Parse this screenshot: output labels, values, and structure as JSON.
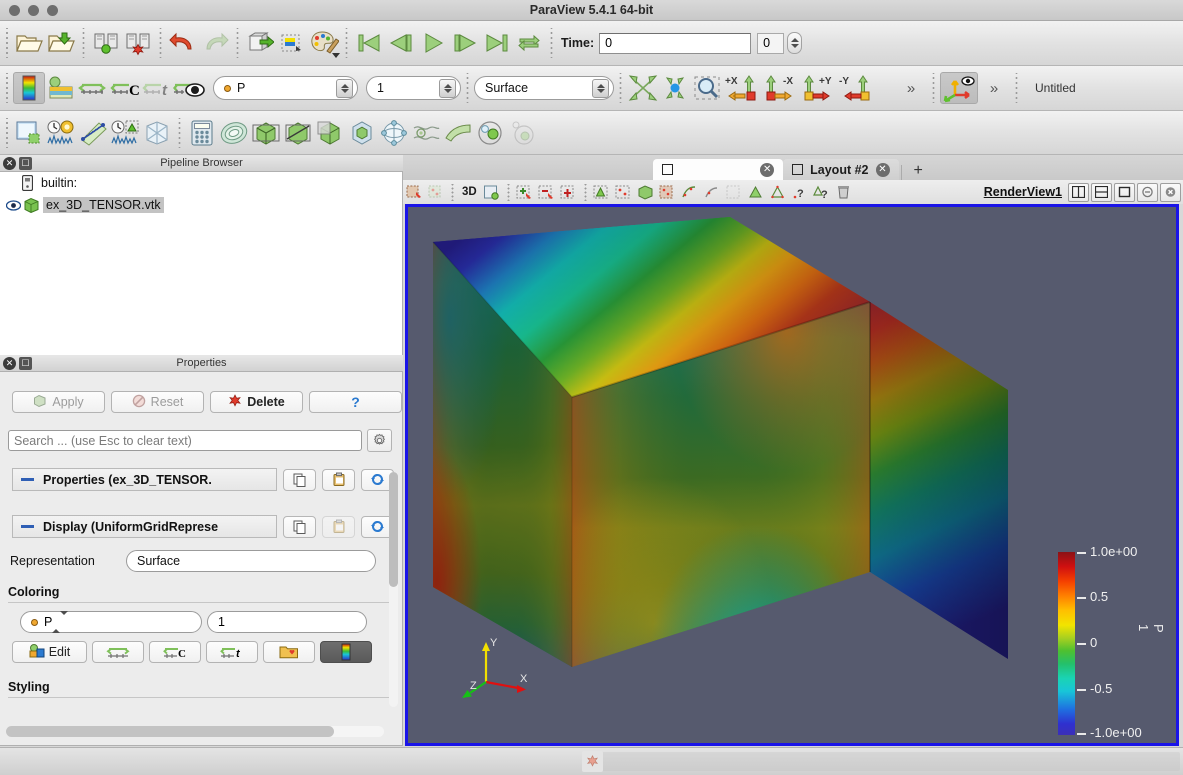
{
  "window": {
    "title": "ParaView 5.4.1 64-bit",
    "traffic_lights": [
      "close",
      "minimize",
      "zoom"
    ]
  },
  "main_toolbar": {
    "buttons": [
      {
        "name": "open-file-icon",
        "label": "Open"
      },
      {
        "name": "save-data-icon",
        "label": "Save Data"
      },
      {
        "name": "connect-server-icon",
        "label": "Connect"
      },
      {
        "name": "disconnect-server-icon",
        "label": "Disconnect"
      },
      {
        "name": "undo-icon",
        "label": "Undo"
      },
      {
        "name": "redo-icon",
        "label": "Redo"
      },
      {
        "name": "undo-camera-icon",
        "label": "Undo Camera"
      },
      {
        "name": "redo-camera-icon",
        "label": "Redo Camera"
      },
      {
        "name": "color-palette-icon",
        "label": "Edit Color Palette"
      }
    ]
  },
  "vcr_toolbar": {
    "buttons": [
      {
        "name": "first-frame-icon",
        "label": "First Frame"
      },
      {
        "name": "previous-frame-icon",
        "label": "Previous Frame"
      },
      {
        "name": "play-icon",
        "label": "Play"
      },
      {
        "name": "next-frame-icon",
        "label": "Next Frame"
      },
      {
        "name": "last-frame-icon",
        "label": "Last Frame"
      },
      {
        "name": "loop-icon",
        "label": "Loop"
      }
    ],
    "time_label": "Time:",
    "time_value": "0",
    "frame_value": "0"
  },
  "rep_toolbar": {
    "active_scalars_icon": "colormap-icon",
    "buttons": [
      {
        "name": "rescale-to-data-range-icon",
        "label": "Rescale to Data Range"
      },
      {
        "name": "rescale-custom-range-icon",
        "label": "Rescale to Custom Range"
      },
      {
        "name": "rescale-temporal-range-icon",
        "label": "Rescale to Temporal Range"
      },
      {
        "name": "rescale-visible-range-icon",
        "label": "Rescale to Visible Range"
      },
      {
        "name": "toggle-color-legend-icon",
        "label": "Toggle Color Legend"
      }
    ],
    "array_value": "P",
    "component_value": "1",
    "representation_value": "Surface",
    "camera_buttons": [
      {
        "name": "reset-camera-icon",
        "label": "Reset"
      },
      {
        "name": "zoom-to-data-icon",
        "label": "Zoom To Data"
      },
      {
        "name": "zoom-to-box-icon",
        "label": "Zoom To Box"
      },
      {
        "name": "pos-x-icon",
        "label": "+X"
      },
      {
        "name": "neg-x-icon",
        "label": "-X"
      },
      {
        "name": "pos-y-icon",
        "label": "+Y"
      },
      {
        "name": "neg-y-icon",
        "label": "-Y"
      }
    ],
    "overflow_label": "»",
    "orientation_axes_icon": "show-orientation-axes-icon",
    "untitled_label": "Untitled"
  },
  "filters_toolbar": {
    "buttons": [
      {
        "name": "extract-selection-icon",
        "label": "Extract Selection"
      },
      {
        "name": "plot-over-time-icon",
        "label": "Plot Data Over Time"
      },
      {
        "name": "plot-over-line-icon",
        "label": "Plot Over Line"
      },
      {
        "name": "plot-selection-over-time-icon",
        "label": "Plot Selection Over Time"
      },
      {
        "name": "glyph-icon",
        "label": "Glyph"
      },
      {
        "name": "calculator-icon",
        "label": "Calculator"
      },
      {
        "name": "contour-icon",
        "label": "Contour"
      },
      {
        "name": "clip-icon",
        "label": "Clip"
      },
      {
        "name": "slice-icon",
        "label": "Slice"
      },
      {
        "name": "threshold-icon",
        "label": "Threshold"
      },
      {
        "name": "extract-subset-icon",
        "label": "Extract Subset"
      },
      {
        "name": "stream-tracer-icon",
        "label": "Stream Tracer"
      },
      {
        "name": "warp-icon",
        "label": "Warp By Vector"
      },
      {
        "name": "group-datasets-icon",
        "label": "Group Datasets"
      },
      {
        "name": "extract-level-icon",
        "label": "Extract Level"
      }
    ]
  },
  "pipeline_browser": {
    "title": "Pipeline Browser",
    "items": [
      {
        "label": "builtin:",
        "icon": "server-icon",
        "selected": false,
        "visible": false
      },
      {
        "label": "ex_3D_TENSOR.vtk",
        "icon": "dataset-icon",
        "selected": true,
        "visible": true
      }
    ]
  },
  "properties_panel": {
    "title": "Properties",
    "buttons": [
      {
        "name": "apply-button",
        "label": "Apply",
        "enabled": false,
        "icon": "apply-icon"
      },
      {
        "name": "reset-button",
        "label": "Reset",
        "enabled": false,
        "icon": "reset-icon"
      },
      {
        "name": "delete-button",
        "label": "Delete",
        "enabled": true,
        "icon": "delete-icon"
      },
      {
        "name": "help-button",
        "label": "",
        "enabled": true,
        "icon": "help-icon"
      }
    ],
    "search_placeholder": "Search ... (use Esc to clear text)",
    "gear_icon": "advanced-properties-icon",
    "sections": [
      {
        "name": "properties-section",
        "label": "Properties (ex_3D_TENSOR."
      },
      {
        "name": "display-section",
        "label": "Display (UniformGridRepresе"
      }
    ],
    "section_buttons": [
      {
        "name": "copy-icon",
        "label": "Copy"
      },
      {
        "name": "paste-icon",
        "label": "Paste"
      },
      {
        "name": "restore-defaults-icon",
        "label": "Restore Defaults"
      }
    ],
    "representation": {
      "label": "Representation",
      "value": "Surface"
    },
    "coloring": {
      "header": "Coloring",
      "array_value": "P",
      "component_value": "1",
      "buttons": [
        {
          "name": "edit-color-map-button",
          "label": "Edit",
          "icon": "edit-colormap-icon"
        },
        {
          "name": "rescale-data-range-button",
          "label": "",
          "icon": "rescale-data-range-icon"
        },
        {
          "name": "rescale-custom-button",
          "label": "",
          "icon": "rescale-custom-icon"
        },
        {
          "name": "rescale-temporal-button",
          "label": "",
          "icon": "rescale-temporal-icon"
        },
        {
          "name": "choose-preset-button",
          "label": "",
          "icon": "favorites-icon"
        },
        {
          "name": "show-color-legend-button",
          "label": "",
          "icon": "color-legend-icon"
        }
      ]
    },
    "styling": {
      "header": "Styling"
    }
  },
  "layout_tabs": {
    "tabs": [
      {
        "name": "layout-tab-1",
        "label": "",
        "active": true
      },
      {
        "name": "layout-tab-2",
        "label": "Layout #2",
        "active": false
      }
    ],
    "add_label": "+"
  },
  "view_toolbar": {
    "mode_label": "3D",
    "buttons": [
      {
        "name": "select-cells-on-icon",
        "label": "Select Cells On"
      },
      {
        "name": "select-points-on-icon",
        "label": "Select Points On"
      },
      {
        "name": "select-cells-through-icon",
        "label": "Select Cells Through"
      },
      {
        "name": "select-points-through-icon",
        "label": "Select Points Through"
      },
      {
        "name": "select-block-icon",
        "label": "Select Block"
      },
      {
        "name": "interactive-select-cells-icon",
        "label": "Interactive Select Cells"
      },
      {
        "name": "interactive-select-points-icon",
        "label": "Interactive Select Points"
      },
      {
        "name": "hover-cells-icon",
        "label": "Hover Cells"
      },
      {
        "name": "hover-points-icon",
        "label": "Hover Points"
      },
      {
        "name": "frustum-cells-icon",
        "label": "Frustum Cells"
      },
      {
        "name": "frustum-points-icon",
        "label": "Frustum Points"
      },
      {
        "name": "select-polygon-cells-icon",
        "label": "Polygon Cells"
      },
      {
        "name": "select-polygon-points-icon",
        "label": "Polygon Points"
      },
      {
        "name": "grow-selection-icon",
        "label": "Grow Selection"
      },
      {
        "name": "shrink-selection-icon",
        "label": "Shrink Selection"
      },
      {
        "name": "clear-selection-icon",
        "label": "Clear Selection"
      }
    ],
    "view_name": "RenderView1",
    "window_buttons": [
      {
        "name": "split-horizontal-icon",
        "label": "Split Horizontal"
      },
      {
        "name": "split-vertical-icon",
        "label": "Split Vertical"
      },
      {
        "name": "maximize-view-icon",
        "label": "Maximize"
      },
      {
        "name": "undock-view-icon",
        "label": "Undock"
      },
      {
        "name": "close-view-icon",
        "label": "Close"
      }
    ]
  },
  "render_view": {
    "background_color": "#565a6e",
    "border_color": "#1a14e8",
    "orientation_axes": {
      "x_label": "X",
      "y_label": "Y",
      "z_label": "Z",
      "x_color": "#e01010",
      "y_color": "#f2e000",
      "z_color": "#16c016"
    },
    "object": {
      "name": "ex_3D_TENSOR.vtk",
      "representation": "Surface",
      "colored_by": "P"
    }
  },
  "chart_data": {
    "type": "heatmap",
    "title": "P",
    "legend_title": "P 1",
    "colormap": "Blue to Red Rainbow",
    "tick_labels": [
      "1.0e+00",
      "0.5",
      "0",
      "-0.5",
      "-1.0e+00"
    ],
    "tick_values": [
      1.0,
      0.5,
      0,
      -0.5,
      -1.0
    ],
    "range": [
      -1.0,
      1.0
    ],
    "legend_position": "right",
    "colormap_stops": [
      {
        "value": -1.0,
        "color": "#3b2fb8"
      },
      {
        "value": -0.75,
        "color": "#1f6fe0"
      },
      {
        "value": -0.5,
        "color": "#18c6d8"
      },
      {
        "value": -0.25,
        "color": "#24c06a"
      },
      {
        "value": 0.0,
        "color": "#a8d020"
      },
      {
        "value": 0.25,
        "color": "#ffc000"
      },
      {
        "value": 0.5,
        "color": "#ff8000"
      },
      {
        "value": 0.75,
        "color": "#d01010"
      },
      {
        "value": 1.0,
        "color": "#8b1216"
      }
    ]
  },
  "status_bar": {
    "abort_icon": "abort-icon",
    "progress": ""
  }
}
